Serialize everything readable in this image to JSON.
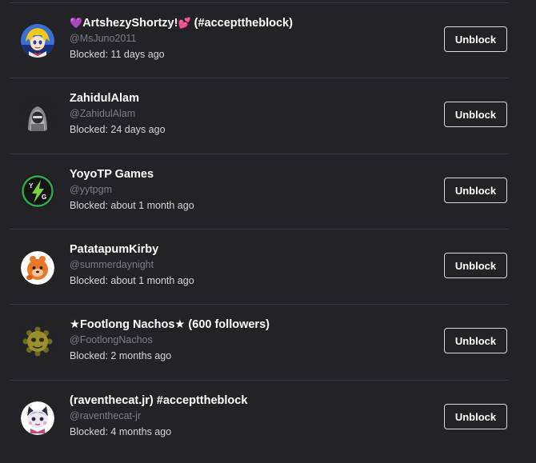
{
  "blocked_users": [
    {
      "name_prefix": "💜",
      "name": "ArtshezyShortzy!",
      "name_emoji": "💕",
      "name_suffix": " (#accepttheblock)",
      "handle": "@MsJuno2011",
      "blocked": "Blocked: 11 days ago",
      "button": "Unblock",
      "avatar": "anime-character-avatar"
    },
    {
      "name": "ZahidulAlam",
      "handle": "@ZahidulAlam",
      "blocked": "Blocked: 24 days ago",
      "button": "Unblock",
      "avatar": "hooded-figure-avatar"
    },
    {
      "name": "YoyoTP Games",
      "handle": "@yytpgm",
      "blocked": "Blocked: about 1 month ago",
      "button": "Unblock",
      "avatar": "ytg-lightning-logo-avatar"
    },
    {
      "name": "PatatapumKirby",
      "handle": "@summerdaynight",
      "blocked": "Blocked: about 1 month ago",
      "button": "Unblock",
      "avatar": "orange-character-avatar"
    },
    {
      "name": "★Footlong Nachos★ (600 followers)",
      "handle": "@FootlongNachos",
      "blocked": "Blocked: 2 months ago",
      "button": "Unblock",
      "avatar": "sun-face-avatar"
    },
    {
      "name": "(raventhecat.jr) #accepttheblock",
      "handle": "@raventhecat-jr",
      "blocked": "Blocked: 4 months ago",
      "button": "Unblock",
      "avatar": "cartoon-cat-avatar"
    }
  ],
  "colors": {
    "background": "#232227",
    "divider": "#393840",
    "text_primary": "#ffffff",
    "text_handle": "#7e7d85",
    "text_status": "#d6d6db",
    "button_border": "#d9d9de"
  }
}
